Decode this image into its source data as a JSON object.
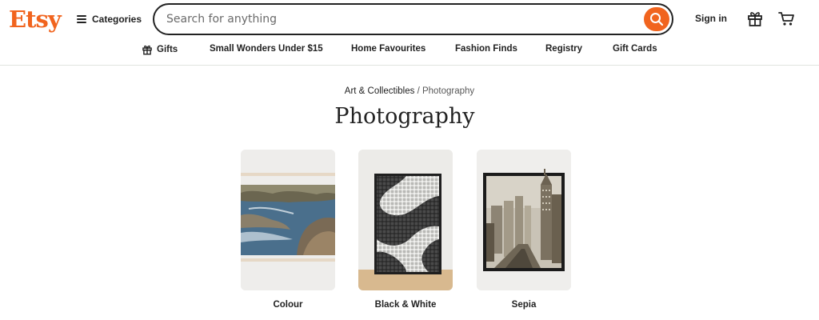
{
  "brand": {
    "name": "Etsy",
    "color": "#f1641e"
  },
  "header": {
    "categories_label": "Categories",
    "search_placeholder": "Search for anything",
    "search_value": "",
    "signin_label": "Sign in",
    "icons": {
      "menu": "hamburger-icon",
      "search": "search-icon",
      "gift": "gift-icon",
      "cart": "cart-icon"
    }
  },
  "subnav": {
    "items": [
      {
        "label": "Gifts",
        "icon": "gift-icon"
      },
      {
        "label": "Small Wonders Under $15"
      },
      {
        "label": "Home Favourites"
      },
      {
        "label": "Fashion Finds"
      },
      {
        "label": "Registry"
      },
      {
        "label": "Gift Cards"
      }
    ]
  },
  "breadcrumb": {
    "parent": "Art & Collectibles",
    "separator": "/",
    "current": "Photography"
  },
  "page_title": "Photography",
  "categories": [
    {
      "label": "Colour",
      "image": "coastal-landscape-photo"
    },
    {
      "label": "Black & White",
      "image": "mosaic-pavement-print"
    },
    {
      "label": "Sepia",
      "image": "city-skyline-framed-print"
    }
  ]
}
